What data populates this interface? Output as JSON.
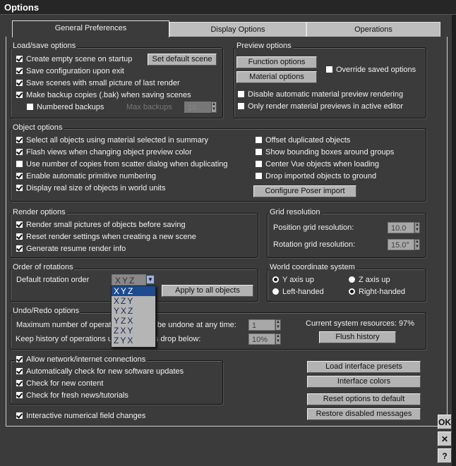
{
  "window": {
    "title": "Options"
  },
  "tabs": [
    "General Preferences",
    "Display Options",
    "Operations"
  ],
  "load_save": {
    "title": "Load/save options",
    "items": [
      {
        "label": "Create empty scene on startup",
        "checked": true
      },
      {
        "label": "Save configuration upon exit",
        "checked": true
      },
      {
        "label": "Save scenes with small picture of last render",
        "checked": true
      },
      {
        "label": "Make backup copies (.bak) when saving scenes",
        "checked": true
      },
      {
        "label": "Numbered backups",
        "checked": false
      }
    ],
    "set_default_scene": "Set default scene",
    "max_backups_label": "Max backups",
    "max_backups_value": "10"
  },
  "preview": {
    "title": "Preview options",
    "function_options": "Function options",
    "material_options": "Material options",
    "items": [
      {
        "label": "Override saved options",
        "checked": false
      },
      {
        "label": "Disable automatic material preview rendering",
        "checked": false
      },
      {
        "label": "Only render material previews in active editor",
        "checked": false
      }
    ]
  },
  "object": {
    "title": "Object options",
    "left": [
      {
        "label": "Select all objects using material selected in summary",
        "checked": true
      },
      {
        "label": "Flash views when changing object preview color",
        "checked": true
      },
      {
        "label": "Use number of copies from scatter dialog when duplicating",
        "checked": false
      },
      {
        "label": "Enable automatic primitive numbering",
        "checked": true
      },
      {
        "label": "Display real size of objects in world units",
        "checked": true
      }
    ],
    "right": [
      {
        "label": "Offset duplicated objects",
        "checked": false
      },
      {
        "label": "Show bounding boxes around groups",
        "checked": false
      },
      {
        "label": "Center Vue objects when loading",
        "checked": false
      },
      {
        "label": "Drop imported objects to ground",
        "checked": false
      }
    ],
    "configure_poser": "Configure Poser import"
  },
  "render": {
    "title": "Render options",
    "items": [
      {
        "label": "Render small pictures of objects before saving",
        "checked": true
      },
      {
        "label": "Reset render settings when creating a new scene",
        "checked": true
      },
      {
        "label": "Generate resume render info",
        "checked": true
      }
    ]
  },
  "grid": {
    "title": "Grid resolution",
    "position_label": "Position grid resolution:",
    "position_value": "10.0",
    "rotation_label": "Rotation grid resolution:",
    "rotation_value": "15.0°"
  },
  "rotations": {
    "title": "Order of rotations",
    "label": "Default rotation order",
    "value": "XYZ",
    "options": [
      "XYZ",
      "XZY",
      "YXZ",
      "YZX",
      "ZXY",
      "ZYX"
    ],
    "apply": "Apply to all objects"
  },
  "world": {
    "title": "World coordinate system",
    "y_up": "Y axis up",
    "z_up": "Z axis up",
    "left_handed": "Left-handed",
    "right_handed": "Right-handed"
  },
  "undo": {
    "title": "Undo/Redo options",
    "max_label": "Maximum number of operations that can be undone at any time:",
    "max_value": "1",
    "keep_label": "Keep history of operations until resources drop below:",
    "keep_value": "10%",
    "resources": "Current system resources: 97%",
    "flush": "Flush history"
  },
  "network": {
    "items": [
      {
        "label": "Allow network/internet connections",
        "checked": true
      },
      {
        "label": "Automatically check for new software updates",
        "checked": true
      },
      {
        "label": "Check for new content",
        "checked": true
      },
      {
        "label": "Check for fresh news/tutorials",
        "checked": true
      }
    ]
  },
  "interactive": {
    "label": "Interactive numerical field changes",
    "checked": true
  },
  "buttons": {
    "load_presets": "Load interface presets",
    "interface_colors": "Interface colors",
    "reset": "Reset options to default",
    "restore": "Restore disabled messages"
  },
  "side": {
    "ok": "OK",
    "cancel": "✕",
    "help": "?"
  }
}
